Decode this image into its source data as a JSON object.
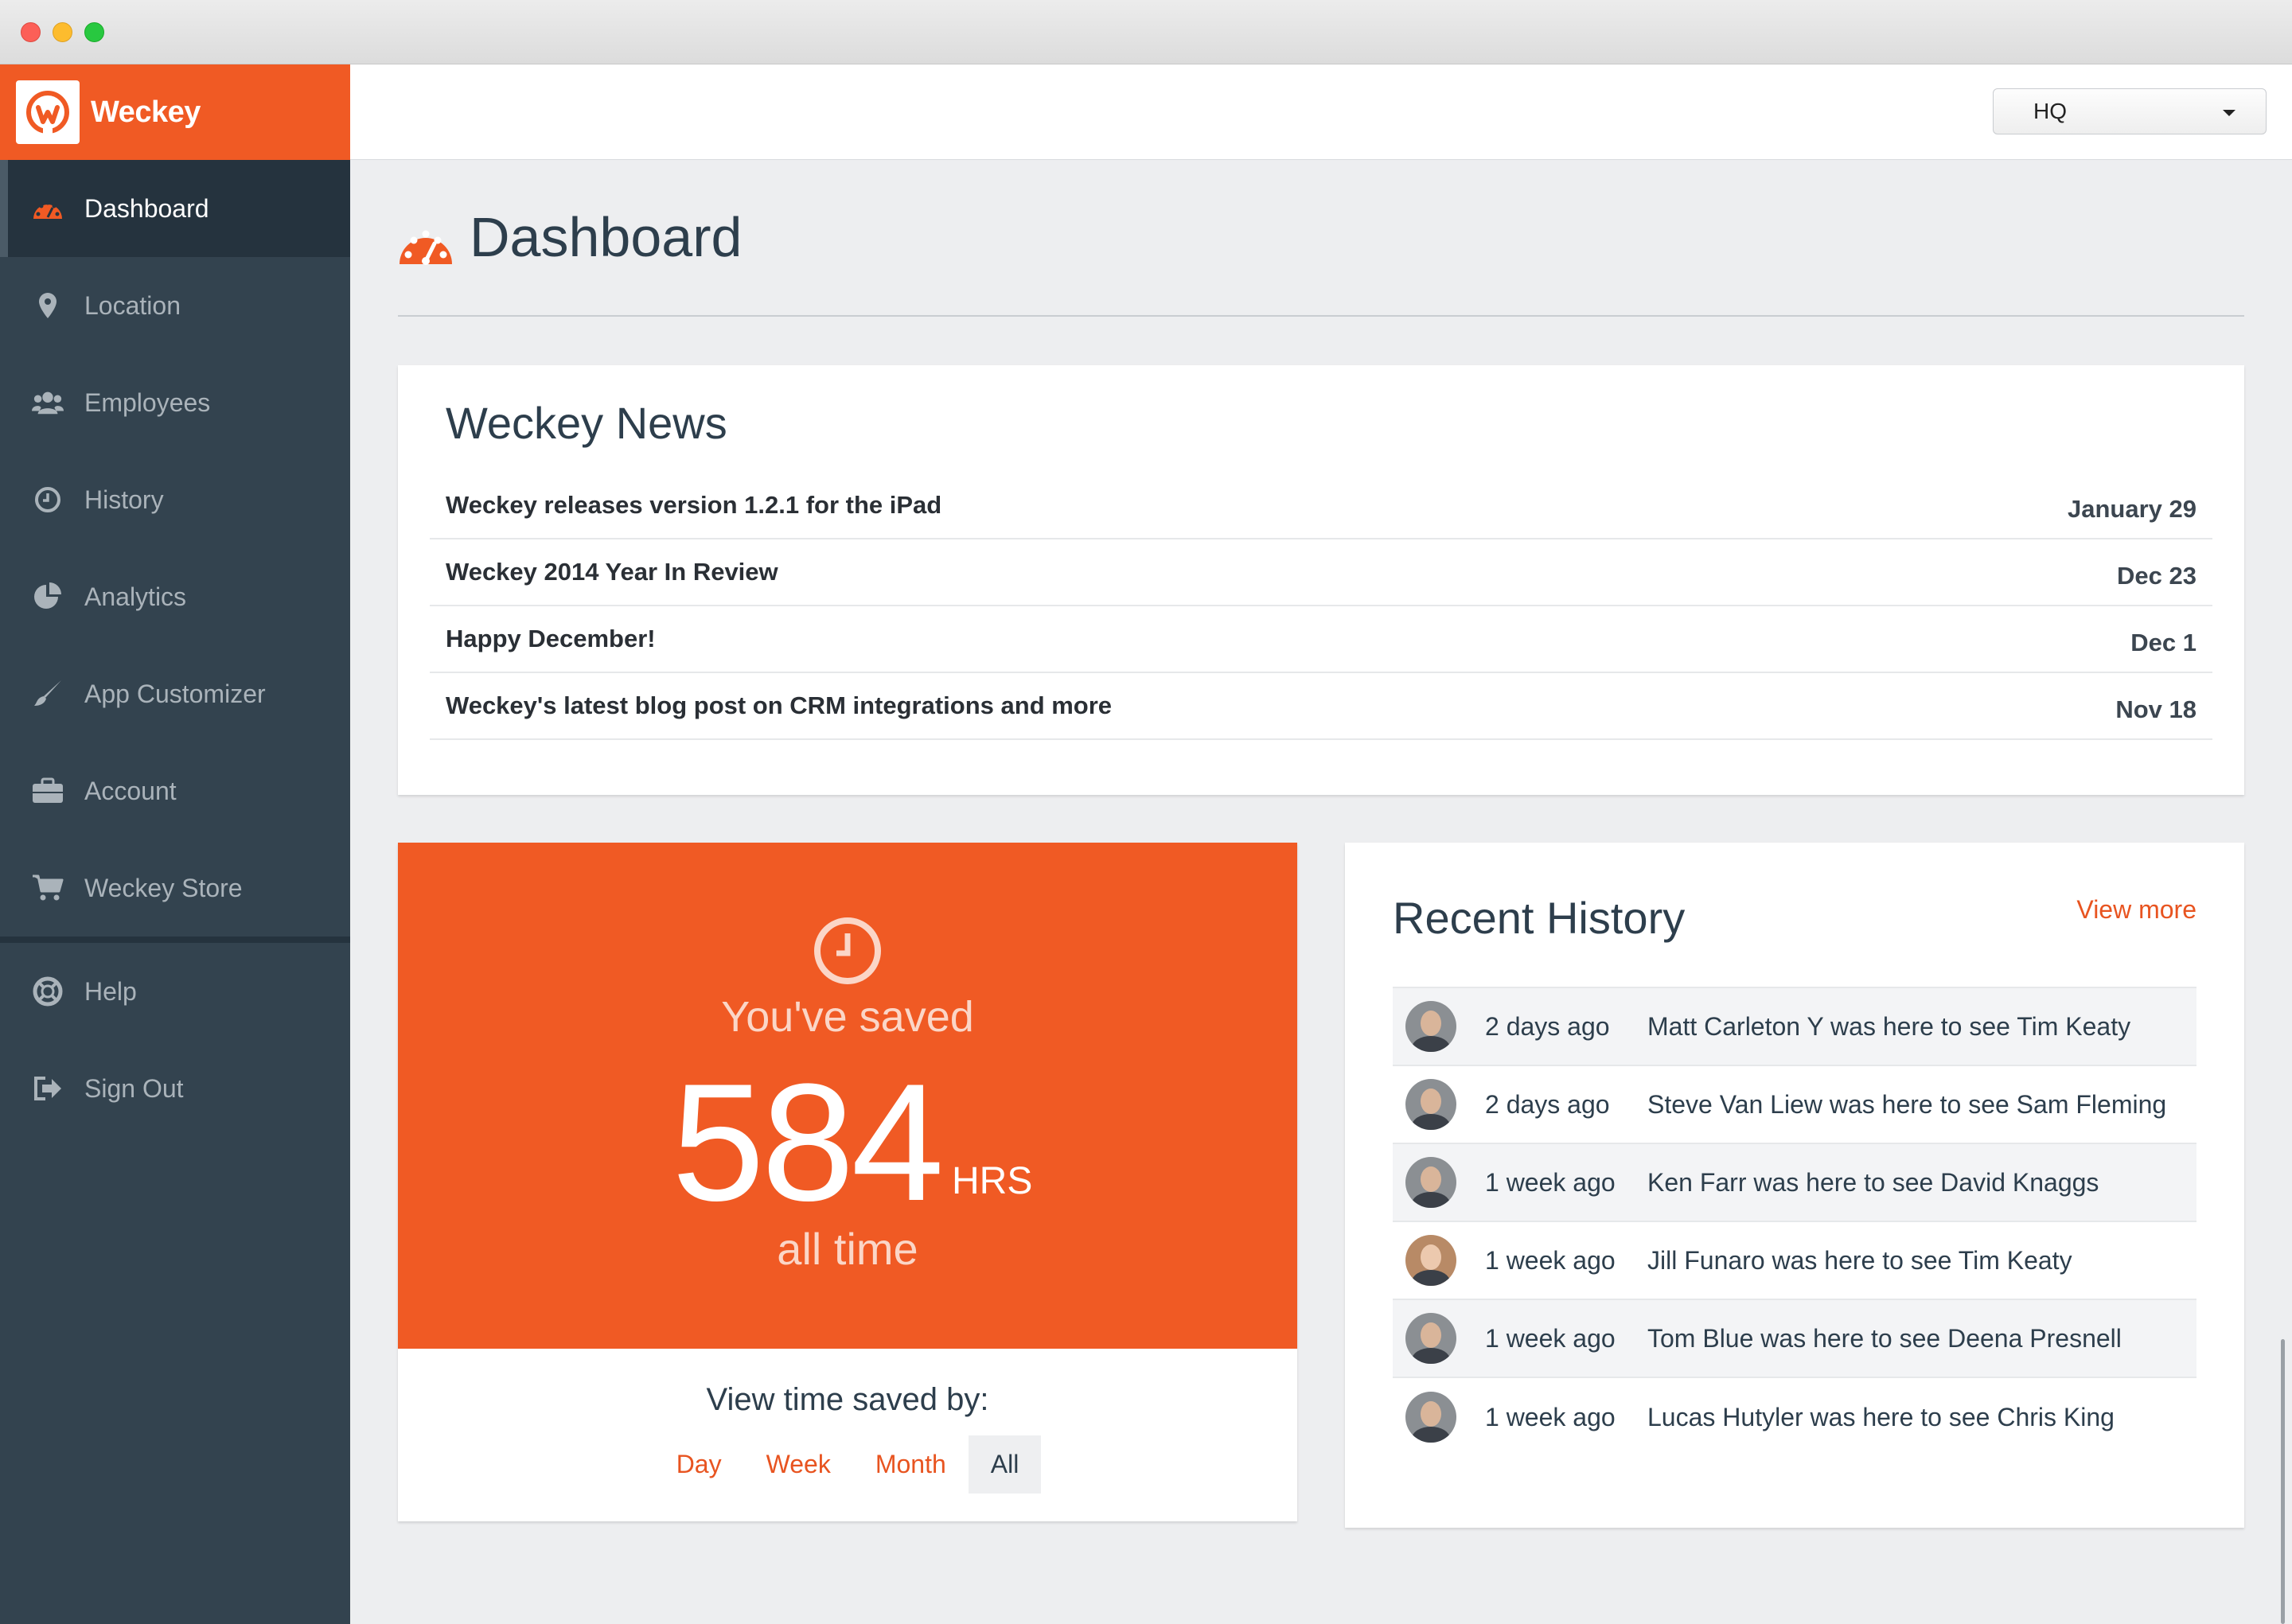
{
  "brand": {
    "name": "Weckey",
    "accent": "#f05a24"
  },
  "sidebar": {
    "items": [
      {
        "label": "Dashboard",
        "icon": "dashboard-icon",
        "active": true
      },
      {
        "label": "Location",
        "icon": "location-pin-icon"
      },
      {
        "label": "Employees",
        "icon": "users-icon"
      },
      {
        "label": "History",
        "icon": "clock-icon"
      },
      {
        "label": "Analytics",
        "icon": "pie-chart-icon"
      },
      {
        "label": "App Customizer",
        "icon": "brush-icon"
      },
      {
        "label": "Account",
        "icon": "briefcase-icon"
      },
      {
        "label": "Weckey Store",
        "icon": "cart-icon"
      }
    ],
    "secondary": [
      {
        "label": "Help",
        "icon": "lifebuoy-icon"
      },
      {
        "label": "Sign Out",
        "icon": "sign-out-icon"
      }
    ]
  },
  "topbar": {
    "location_selected": "HQ"
  },
  "page": {
    "title": "Dashboard"
  },
  "news": {
    "title": "Weckey News",
    "items": [
      {
        "title": "Weckey releases version 1.2.1 for the iPad",
        "date": "January 29"
      },
      {
        "title": "Weckey 2014 Year In Review",
        "date": "Dec 23"
      },
      {
        "title": "Happy December!",
        "date": "Dec 1"
      },
      {
        "title": "Weckey's latest blog post on CRM integrations and more",
        "date": "Nov 18"
      }
    ]
  },
  "saved": {
    "label": "You've saved",
    "value": "584",
    "unit": "HRS",
    "period": "all time",
    "view_by_label": "View time saved by:",
    "tabs": [
      "Day",
      "Week",
      "Month",
      "All"
    ],
    "active_tab": "All"
  },
  "history": {
    "title": "Recent History",
    "view_more": "View more",
    "items": [
      {
        "time": "2 days ago",
        "text": "Matt Carleton Y was here to see Tim Keaty"
      },
      {
        "time": "2 days ago",
        "text": "Steve Van Liew was here to see Sam Fleming"
      },
      {
        "time": "1 week ago",
        "text": "Ken Farr was here to see David Knaggs"
      },
      {
        "time": "1 week ago",
        "text": "Jill Funaro was here to see Tim Keaty"
      },
      {
        "time": "1 week ago",
        "text": "Tom Blue was here to see Deena Presnell"
      },
      {
        "time": "1 week ago",
        "text": "Lucas Hutyler was here to see Chris King"
      }
    ]
  }
}
